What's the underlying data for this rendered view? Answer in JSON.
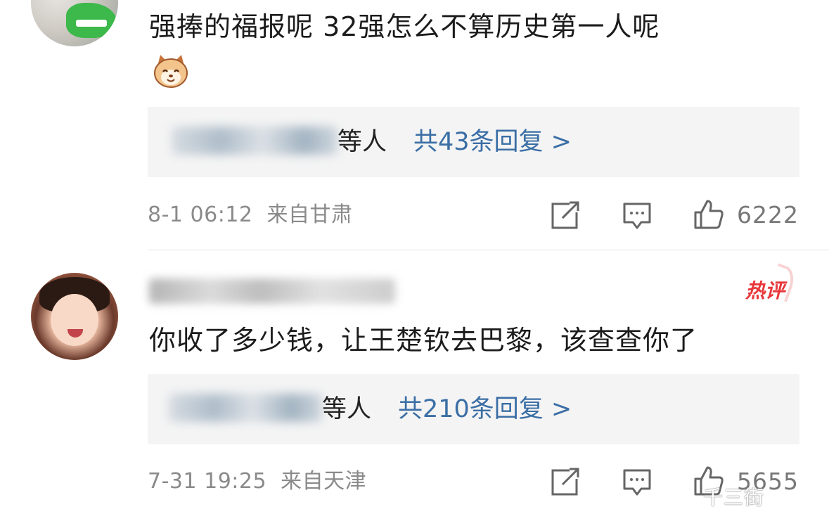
{
  "comments": [
    {
      "text_line1": "强捧的福报呢  32强怎么不算历史第一人呢",
      "emoji_icon": "cat-face-emoji",
      "reply_who": "等人",
      "reply_count": "共43条回复 >",
      "date": "8-1 06:12",
      "location": "来自甘肃",
      "likes": "6222"
    },
    {
      "hot_badge": "热评",
      "text_line1": "你收了多少钱，让王楚钦去巴黎，该查查你了",
      "reply_who": "等人",
      "reply_count": "共210条回复 >",
      "date": "7-31 19:25",
      "location": "来自天津",
      "likes": "5655"
    }
  ],
  "watermark": "千三街",
  "colors": {
    "link": "#3a6ea5",
    "hot": "#e8373a",
    "meta": "#8a8a8a",
    "reply_bg": "#f4f4f4"
  }
}
